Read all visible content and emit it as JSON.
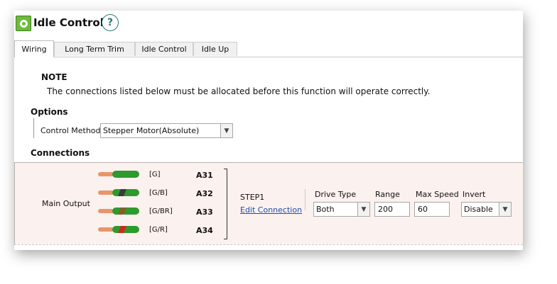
{
  "window": {
    "title": "Idle Control",
    "help_glyph": "?"
  },
  "tabs": [
    {
      "label": "Wiring",
      "active": true
    },
    {
      "label": "Long Term Trim",
      "active": false
    },
    {
      "label": "Idle Control",
      "active": false
    },
    {
      "label": "Idle Up",
      "active": false
    }
  ],
  "note": {
    "heading": "NOTE",
    "text": "The connections listed below must be allocated before this function will operate correctly."
  },
  "options": {
    "heading": "Options",
    "control_method_label": "Control Method",
    "control_method_value": "Stepper Motor(Absolute)"
  },
  "connections": {
    "heading": "Connections",
    "output_label": "Main Output",
    "wires": [
      {
        "label": "[G]",
        "pin": "A31",
        "base_color": "#2e9a2e",
        "stripe_color": null
      },
      {
        "label": "[G/B]",
        "pin": "A32",
        "base_color": "#2e9a2e",
        "stripe_color": "#3a3a3a"
      },
      {
        "label": "[G/BR]",
        "pin": "A33",
        "base_color": "#2e9a2e",
        "stripe_color": "#8b5a2b"
      },
      {
        "label": "[G/R]",
        "pin": "A34",
        "base_color": "#2e9a2e",
        "stripe_color": "#cc2a1f"
      }
    ],
    "step_label": "STEP1",
    "edit_link": "Edit Connection",
    "drive_type_label": "Drive Type",
    "drive_type_value": "Both",
    "range_label": "Range",
    "range_value": "200",
    "max_speed_label": "Max Speed",
    "max_speed_value": "60",
    "invert_label": "Invert",
    "invert_value": "Disable"
  },
  "icons": {
    "app": "idle-control-app-icon",
    "help": "help-icon",
    "dropdown": "chevron-down-icon"
  }
}
